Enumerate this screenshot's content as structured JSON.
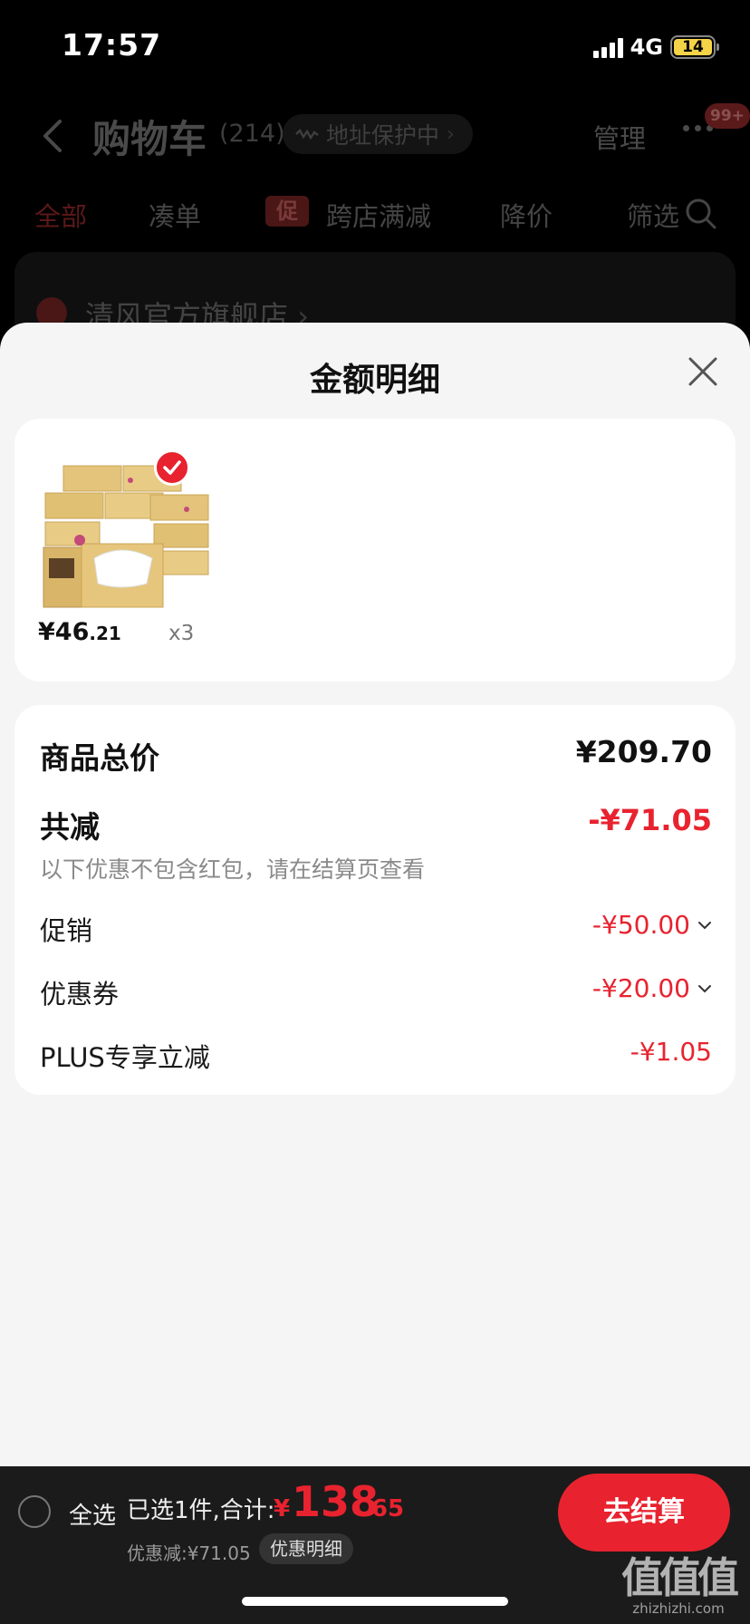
{
  "status_bar": {
    "time": "17:57",
    "network": "4G",
    "battery": "14"
  },
  "cart_page": {
    "title": "购物车",
    "count": "(214)",
    "address_protection": "地址保护中",
    "manage": "管理",
    "more_badge": "99+",
    "filters": {
      "all": "全部",
      "combine": "凑单",
      "promo_tag": "促",
      "cross_store": "跨店满减",
      "price_drop": "降价",
      "filter": "筛选"
    },
    "store_name": "清风官方旗舰店"
  },
  "sheet": {
    "title": "金额明细",
    "product": {
      "price_int": "¥46",
      "price_dec": ".21",
      "quantity": "x3"
    },
    "summary": {
      "total_label": "商品总价",
      "total_value": "¥209.70",
      "discount_label": "共减",
      "discount_value": "-¥71.05",
      "discount_note": "以下优惠不包含红包，请在结算页查看",
      "items": [
        {
          "label": "促销",
          "value": "-¥50.00",
          "expandable": true
        },
        {
          "label": "优惠券",
          "value": "-¥20.00",
          "expandable": true
        },
        {
          "label": "PLUS专享立减",
          "value": "-¥1.05",
          "expandable": false
        }
      ]
    }
  },
  "bottom_bar": {
    "select_all": "全选",
    "selected_summary": "已选1件,合计:",
    "total_symbol": "¥",
    "total_int": "138",
    "total_dec": ".65",
    "discount_total": "优惠减:¥71.05",
    "detail_button": "优惠明细",
    "checkout_button": "去结算"
  },
  "watermark": {
    "glyphs": "值值值",
    "url": "zhizhizhi.com"
  },
  "colors": {
    "accent": "#e8232f",
    "sheet_bg": "#f5f5f5",
    "bottom_bar_bg": "#1b1b1b"
  }
}
